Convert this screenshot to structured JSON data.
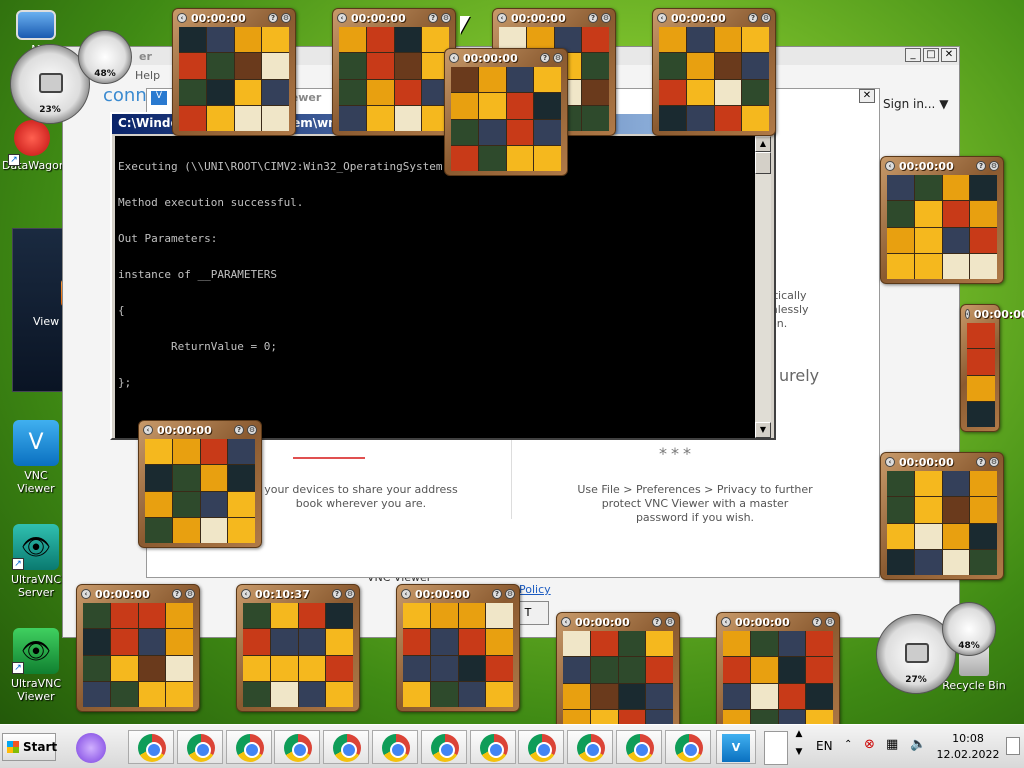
{
  "desktop": {
    "icons": [
      {
        "label": "M",
        "name": "my-computer"
      },
      {
        "label": "DataWagon",
        "name": "datawagon"
      },
      {
        "label": "VNC Viewer",
        "name": "vnc-viewer"
      },
      {
        "label": "UltraVNC Server",
        "name": "ultravnc-server"
      },
      {
        "label": "UltraVNC Viewer",
        "name": "ultravnc-viewer"
      },
      {
        "label": "Recycle Bin",
        "name": "recycle-bin"
      }
    ],
    "feed_widget": {
      "label": "View headlines"
    },
    "gauges": {
      "top_left_cpu": "23%",
      "top_left_mem": "48%",
      "bottom_right_cpu": "27%",
      "bottom_right_mem": "48%"
    }
  },
  "vnc_window": {
    "title_partial": "er",
    "menu_partial": "Help",
    "brand_partial": "conn",
    "inner_title_partial": "iewer",
    "sign_in": "Sign in...",
    "text_right_1": "atically",
    "text_right_2": "mlessly",
    "text_right_3": "ion.",
    "heading_right": "urely",
    "text_left": "your devices to share your address book wherever you are.",
    "password_dots": "***",
    "text_privacy": "Use File > Preferences > Privacy to further protect VNC Viewer with a master password if you wish.",
    "checkbox_label": "Send anonymous usage data to help improve VNC Viewer",
    "link_policy": "Policy",
    "button_partial": "T"
  },
  "cmd_window": {
    "title": "C:\\Windows\\System32\\wbem\\wmic.exe",
    "title_visible_left": "C:\\Win",
    "title_visible_right": "m\\wmic.exe",
    "lines": [
      "Executing (\\\\UNI\\ROOT\\CIMV2:Win32_OperatingSystem...)->Reboot()",
      "Method execution successful.",
      "Out Parameters:",
      "instance of __PARAMETERS",
      "{",
      "        ReturnValue = 0;",
      "};"
    ]
  },
  "puzzles": [
    {
      "timer": "00:00:00"
    },
    {
      "timer": "00:00:00"
    },
    {
      "timer": "00:00:00"
    },
    {
      "timer": "00:00:00"
    },
    {
      "timer": "00:00:00"
    },
    {
      "timer": "00:00:00"
    },
    {
      "timer": "00:00:00"
    },
    {
      "timer": "00:00:00"
    },
    {
      "timer": "00:00:00"
    },
    {
      "timer": "00:00:00"
    },
    {
      "timer": "00:10:37"
    },
    {
      "timer": "00:00:00"
    },
    {
      "timer": "00:00:00"
    },
    {
      "timer": "00:00:00"
    },
    {
      "timer": "00:00:00"
    }
  ],
  "taskbar": {
    "start_label": "Start",
    "language": "EN",
    "time": "10:08",
    "date": "12.02.2022",
    "chrome_count": 12
  }
}
